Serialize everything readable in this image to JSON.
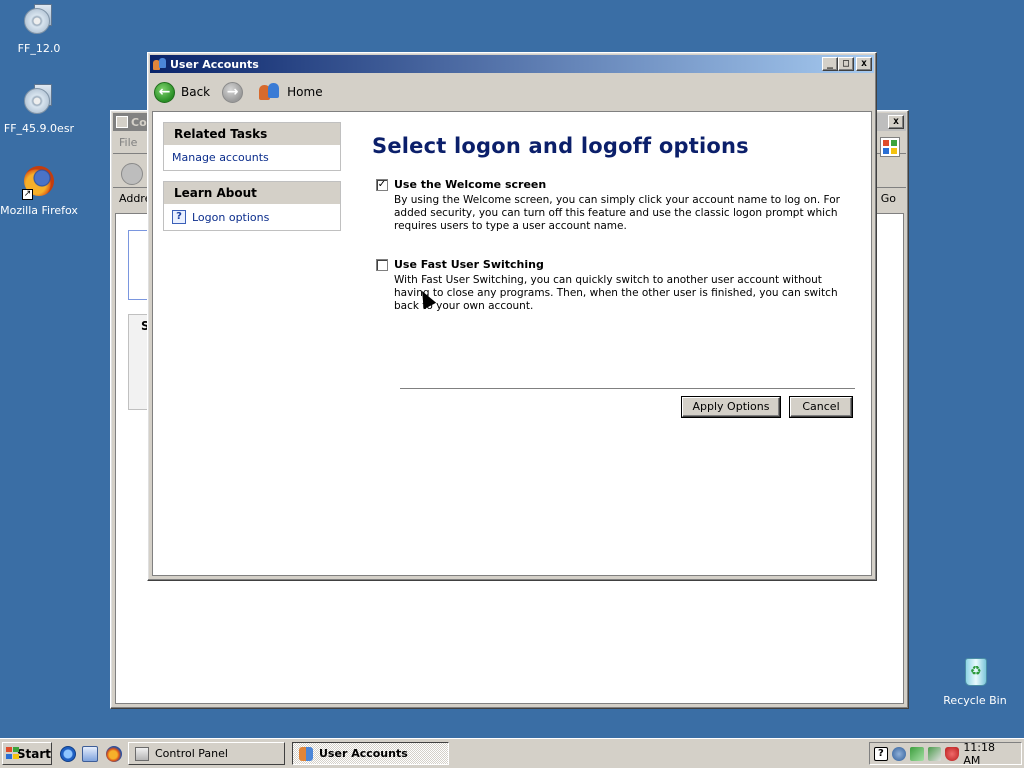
{
  "desktop": {
    "icons": [
      {
        "label": "FF_12.0",
        "icon": "cd-installer-icon"
      },
      {
        "label": "FF_45.9.0esr",
        "icon": "cd-installer-icon"
      },
      {
        "label": "Mozilla Firefox",
        "icon": "firefox-icon"
      },
      {
        "label": "Recycle Bin",
        "icon": "recycle-bin-icon"
      }
    ],
    "background_color": "#3a6ea5"
  },
  "control_panel_window": {
    "title": "Co",
    "menu_first": "File",
    "address_label": "Addre",
    "go_label": "Go",
    "side_letter": "S"
  },
  "user_accounts_window": {
    "title": "User Accounts",
    "nav": {
      "back_label": "Back",
      "home_label": "Home"
    },
    "sidebar": {
      "related_tasks": {
        "heading": "Related Tasks",
        "items": [
          "Manage accounts"
        ]
      },
      "learn_about": {
        "heading": "Learn About",
        "items": [
          "Logon options"
        ]
      }
    },
    "page_title": "Select logon and logoff options",
    "options": [
      {
        "label": "Use the Welcome screen",
        "checked_mark": "✓",
        "checked": true,
        "description": "By using the Welcome screen, you can simply click your account name to log on. For added security, you can turn off this feature and use the classic logon prompt which requires users to type a user account name."
      },
      {
        "label": "Use Fast User Switching",
        "checked_mark": "",
        "checked": false,
        "description": "With Fast User Switching, you can quickly switch to another user account without having to close any programs. Then, when the other user is finished, you can switch back to your own account."
      }
    ],
    "buttons": {
      "apply": "Apply Options",
      "cancel": "Cancel"
    }
  },
  "taskbar": {
    "start_label": "Start",
    "tasks": [
      {
        "label": "Control Panel",
        "active": false
      },
      {
        "label": "User Accounts",
        "active": true
      }
    ],
    "clock": "11:18 AM"
  },
  "colors": {
    "title_active": "#0a246a",
    "link": "#0b2d8c",
    "page_title": "#0b1f6a"
  }
}
